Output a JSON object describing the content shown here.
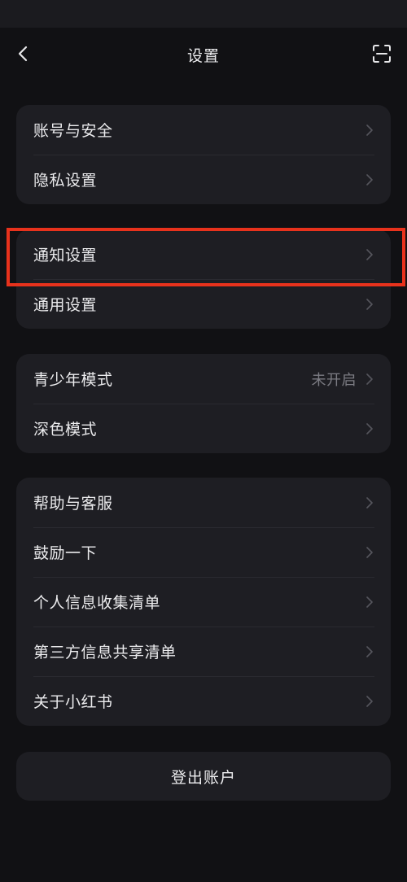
{
  "header": {
    "title": "设置",
    "back_icon": "chevron-left-icon",
    "scan_icon": "scan-icon"
  },
  "groups": [
    {
      "items": [
        {
          "label": "账号与安全"
        },
        {
          "label": "隐私设置"
        }
      ]
    },
    {
      "items": [
        {
          "label": "通知设置"
        },
        {
          "label": "通用设置"
        }
      ]
    },
    {
      "items": [
        {
          "label": "青少年模式",
          "value": "未开启"
        },
        {
          "label": "深色模式"
        }
      ]
    },
    {
      "items": [
        {
          "label": "帮助与客服"
        },
        {
          "label": "鼓励一下"
        },
        {
          "label": "个人信息收集清单"
        },
        {
          "label": "第三方信息共享清单"
        },
        {
          "label": "关于小红书"
        }
      ]
    }
  ],
  "logout": {
    "label": "登出账户"
  },
  "colors": {
    "background": "#111114",
    "card": "#1e1e23",
    "highlight": "#e8321c",
    "secondary_text": "#7b7b82"
  }
}
